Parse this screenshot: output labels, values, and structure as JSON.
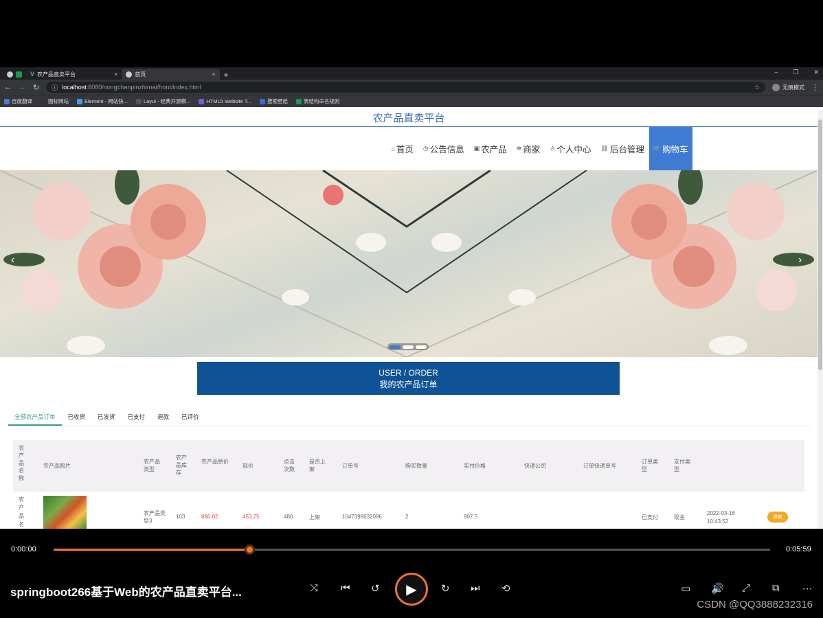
{
  "browser": {
    "tabs": [
      {
        "title": "",
        "type": "icon"
      },
      {
        "title": "农产品直卖平台",
        "icon": "vue-icon",
        "close": "×"
      },
      {
        "title": "首页",
        "icon": "globe-icon",
        "close": "×"
      }
    ],
    "new_tab": "+",
    "window_controls": [
      "–",
      "❐",
      "✕"
    ],
    "url_host": "localhost",
    "url_path": ":8080/nongchanpinzhimai/front/index.html",
    "profile_label": "无痕模式",
    "bookmarks": [
      "百度翻译",
      "图标网站",
      "Element - 网站快...",
      "Layui - 经典开源模...",
      "HTML5 Website T...",
      "搜索壁纸",
      "表结构命名规则"
    ]
  },
  "site": {
    "title": "农产品直卖平台",
    "nav": [
      {
        "label": "首页",
        "icon": "⌂"
      },
      {
        "label": "公告信息",
        "icon": "◷"
      },
      {
        "label": "农产品",
        "icon": "▣"
      },
      {
        "label": "商家",
        "icon": "✲"
      },
      {
        "label": "个人中心",
        "icon": "♙"
      },
      {
        "label": "后台管理",
        "icon": "⛓"
      },
      {
        "label": "购物车",
        "icon": "🛒"
      }
    ],
    "carousel_prev": "‹",
    "carousel_next": "›",
    "order_title_en": "USER / ORDER",
    "order_title_cn": "我的农产品订单"
  },
  "order_tabs": [
    "全部农产品订单",
    "已收货",
    "已发货",
    "已支付",
    "退款",
    "已评价"
  ],
  "table": {
    "headers": {
      "name": "农产品名称",
      "photo": "农产品照片",
      "type": "农产品类型",
      "stock": "农产品库存",
      "orig_price": "农产品原价",
      "price": "现价",
      "clicks": "点击次数",
      "onsale": "是否上架",
      "order_no": "订单号",
      "qty": "购买数量",
      "paid": "实付价格",
      "courier": "快递公司",
      "tracking": "订单快递单号",
      "order_type": "订单类型",
      "pay_type": "支付类型",
      "time": "",
      "op": ""
    },
    "row": {
      "name": "农产品名",
      "type": "农产品类型3",
      "stock": "103",
      "orig_price": "886.02",
      "price": "453.75",
      "clicks": "480",
      "onsale": "上架",
      "order_no": "1647398632086",
      "qty": "2",
      "paid": "907.5",
      "order_type": "已支付",
      "pay_type": "现金",
      "time": "2022-03-16 10:43:52",
      "action": "退款"
    }
  },
  "player": {
    "current": "0:00:00",
    "duration": "0:05:59",
    "progress": 0.273,
    "title": "springboot266基于Web的农产品直卖平台...",
    "watermark": "CSDN @QQ3888232316"
  },
  "colors": {
    "accent": "#3f7bd2",
    "order_banner": "#0f5296",
    "progress": "#f0742d",
    "price_red": "#e04e39"
  }
}
